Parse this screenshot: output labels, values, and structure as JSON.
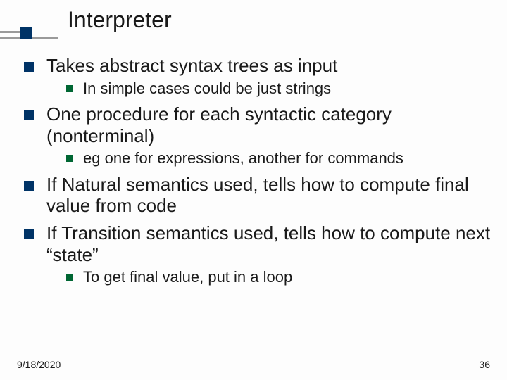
{
  "title": "Interpreter",
  "bullets": {
    "b1": "Takes abstract syntax trees as input",
    "b1a": "In simple cases could be just strings",
    "b2": "One procedure for each syntactic category (nonterminal)",
    "b2a": "eg one for expressions, another for commands",
    "b3": "If Natural semantics used, tells how to compute final value from code",
    "b4": "If Transition semantics used, tells how to compute next “state”",
    "b4a": "To get final value, put in a loop"
  },
  "footer": {
    "date": "9/18/2020",
    "page": "36"
  }
}
